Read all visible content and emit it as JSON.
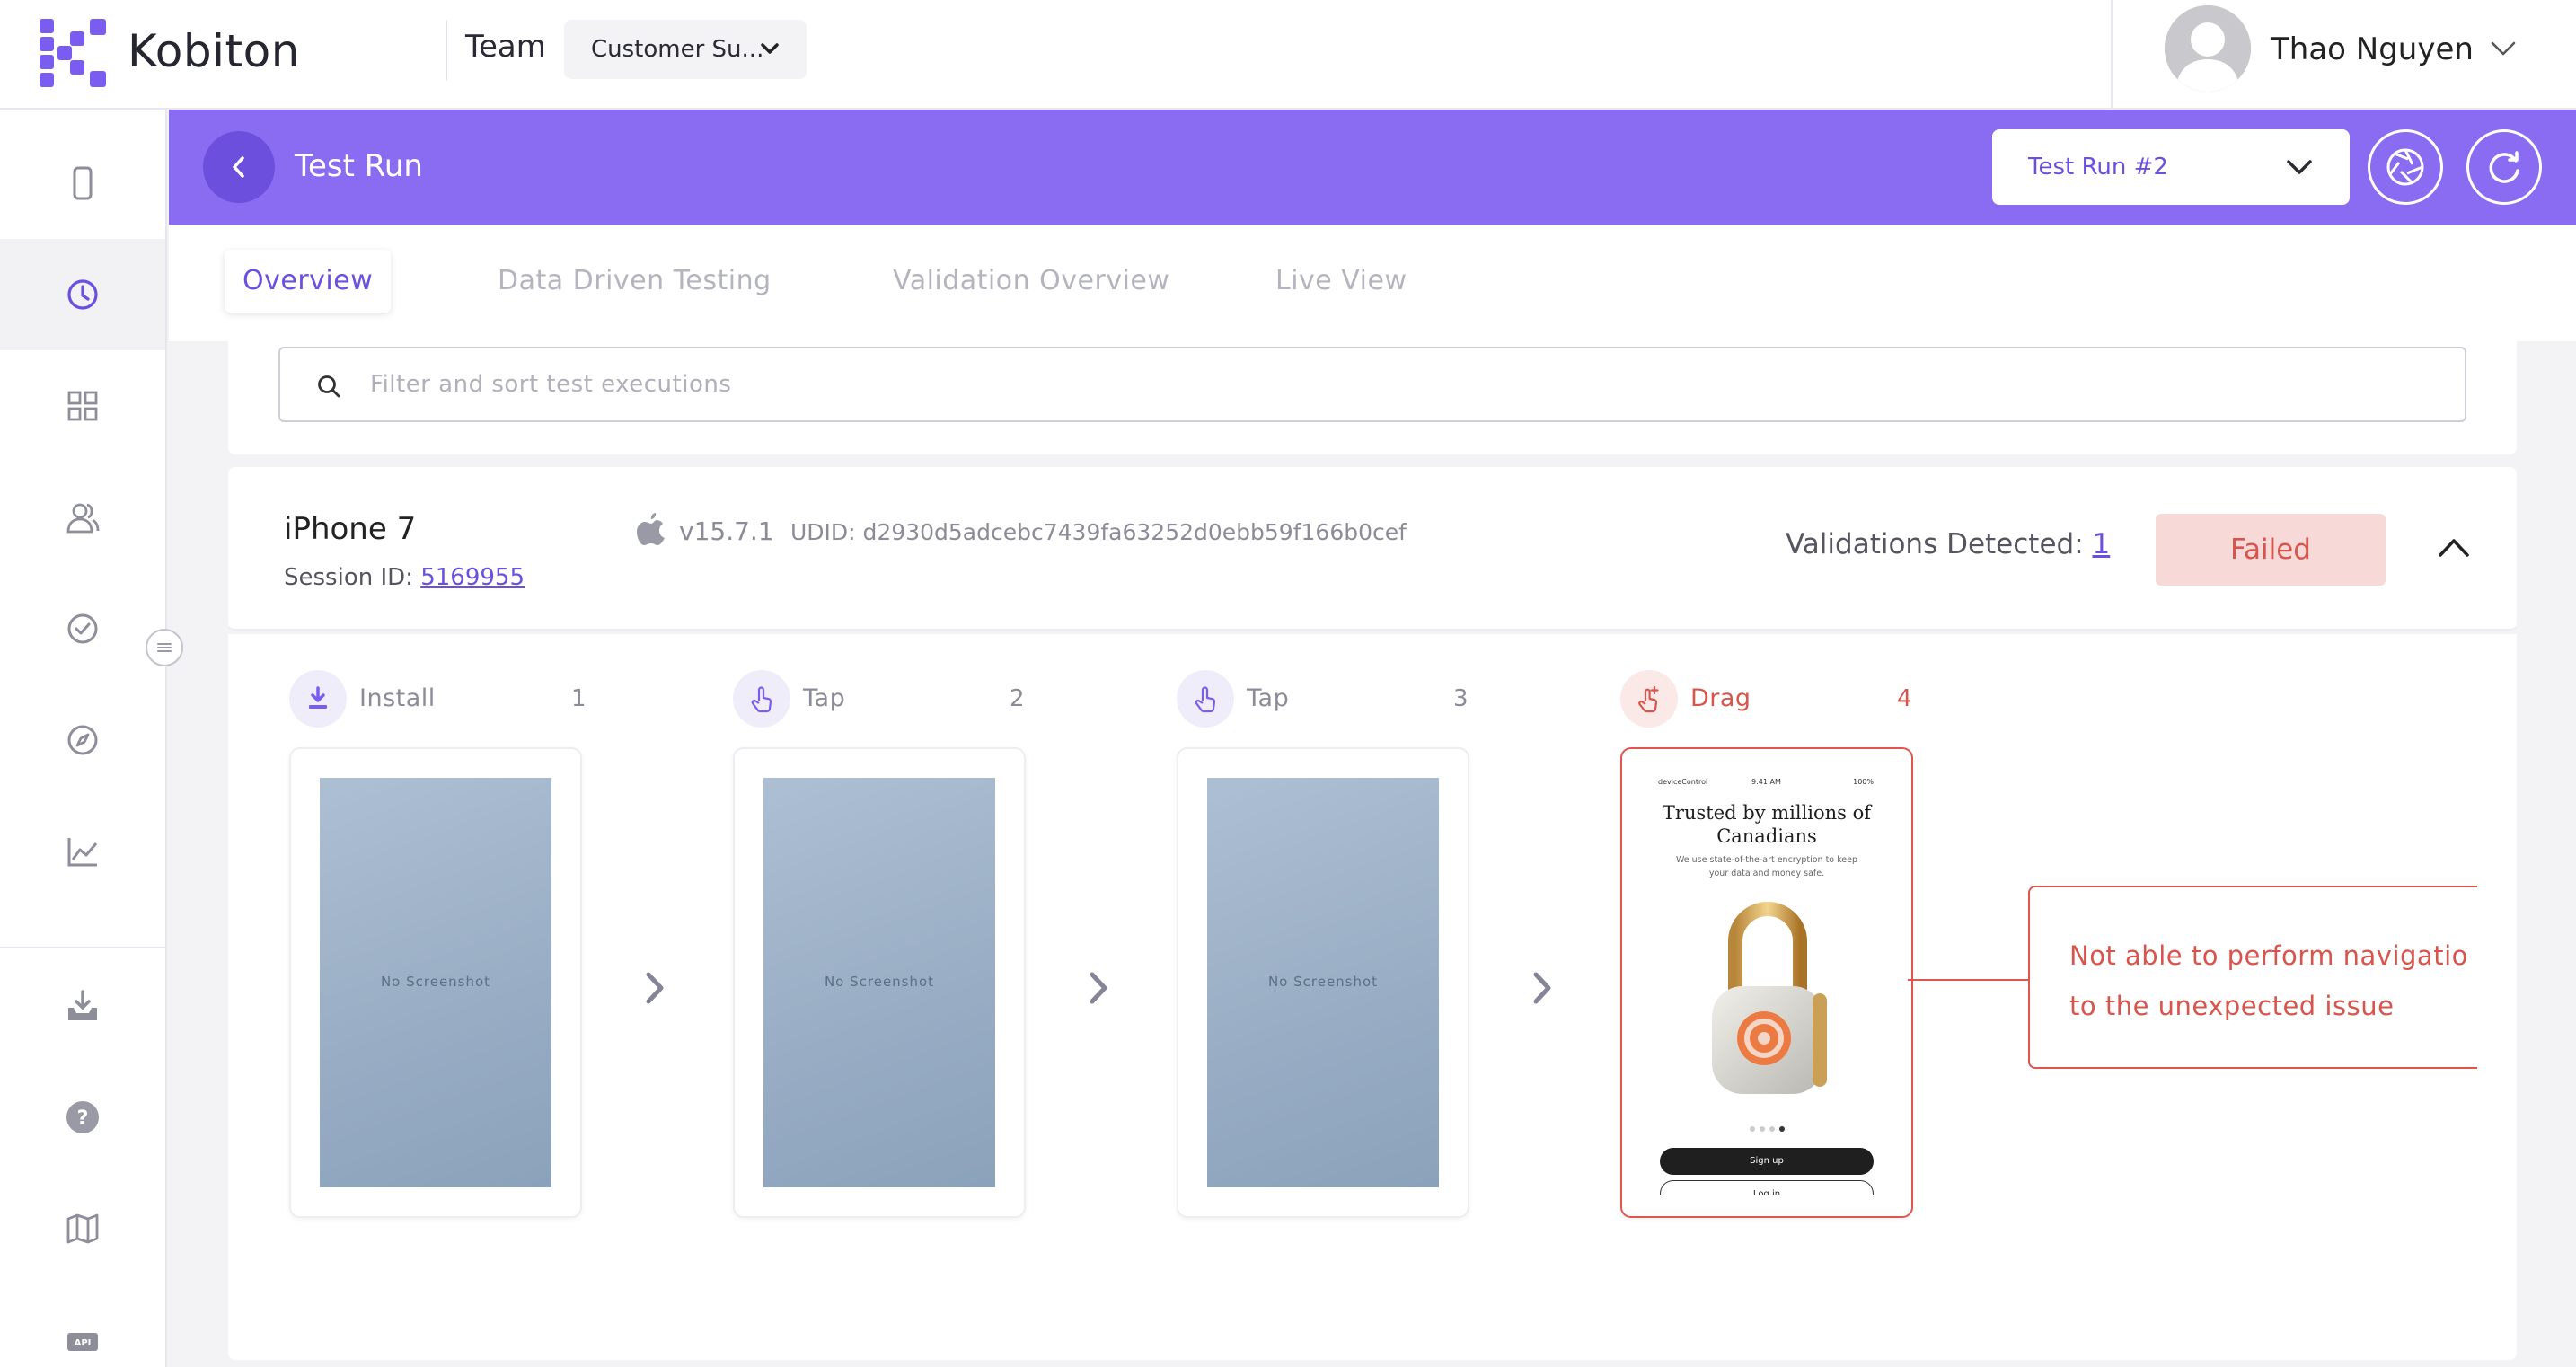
{
  "app": {
    "brand": "Kobiton"
  },
  "topbar": {
    "team_label": "Team",
    "team_value": "Customer Su...",
    "user_name": "Thao Nguyen"
  },
  "sidebar": {
    "items": [
      {
        "icon": "device-icon",
        "active": false
      },
      {
        "icon": "clock-icon",
        "active": true
      },
      {
        "icon": "grid-icon",
        "active": false
      },
      {
        "icon": "users-icon",
        "active": false
      },
      {
        "icon": "check-circle-icon",
        "active": false
      },
      {
        "icon": "compass-icon",
        "active": false
      },
      {
        "icon": "chart-icon",
        "active": false
      },
      {
        "icon": "download-tray-icon",
        "active": false
      },
      {
        "icon": "help-icon",
        "active": false
      },
      {
        "icon": "map-icon",
        "active": false
      },
      {
        "icon": "api-icon",
        "active": false
      }
    ]
  },
  "header": {
    "title": "Test Run",
    "run_select": "Test Run #2"
  },
  "tabs": [
    {
      "label": "Overview",
      "active": true
    },
    {
      "label": "Data Driven Testing",
      "active": false
    },
    {
      "label": "Validation Overview",
      "active": false
    },
    {
      "label": "Live View",
      "active": false
    }
  ],
  "search": {
    "placeholder": "Filter and sort test executions"
  },
  "device": {
    "name": "iPhone 7",
    "session_label": "Session ID:",
    "session_id": "5169955",
    "os_version": "v15.7.1",
    "udid": "UDID: d2930d5adcebc7439fa63252d0ebb59f166b0cef",
    "validations_label": "Validations Detected:",
    "validations_count": "1",
    "status": "Failed",
    "colors": {
      "failed_text": "#d7554d",
      "failed_bg": "#f7d9d7",
      "accent": "#8a6cf2"
    }
  },
  "steps": [
    {
      "action": "Install",
      "number": "1",
      "icon": "download-icon",
      "screenshot": "No Screenshot",
      "error": false
    },
    {
      "action": "Tap",
      "number": "2",
      "icon": "tap-icon",
      "screenshot": "No Screenshot",
      "error": false
    },
    {
      "action": "Tap",
      "number": "3",
      "icon": "tap-icon",
      "screenshot": "No Screenshot",
      "error": false
    },
    {
      "action": "Drag",
      "number": "4",
      "icon": "drag-icon",
      "screenshot": "phone",
      "error": true
    }
  ],
  "phone_screen": {
    "status_left": "deviceControl",
    "status_time": "9:41 AM",
    "status_right": "100%",
    "title": "Trusted by millions of Canadians",
    "subtitle": "We use state-of-the-art encryption to keep your data and money safe.",
    "primary_button": "Sign up",
    "secondary_button": "Log in"
  },
  "error_message": "Not able to perform navigatio\nto the unexpected issue"
}
